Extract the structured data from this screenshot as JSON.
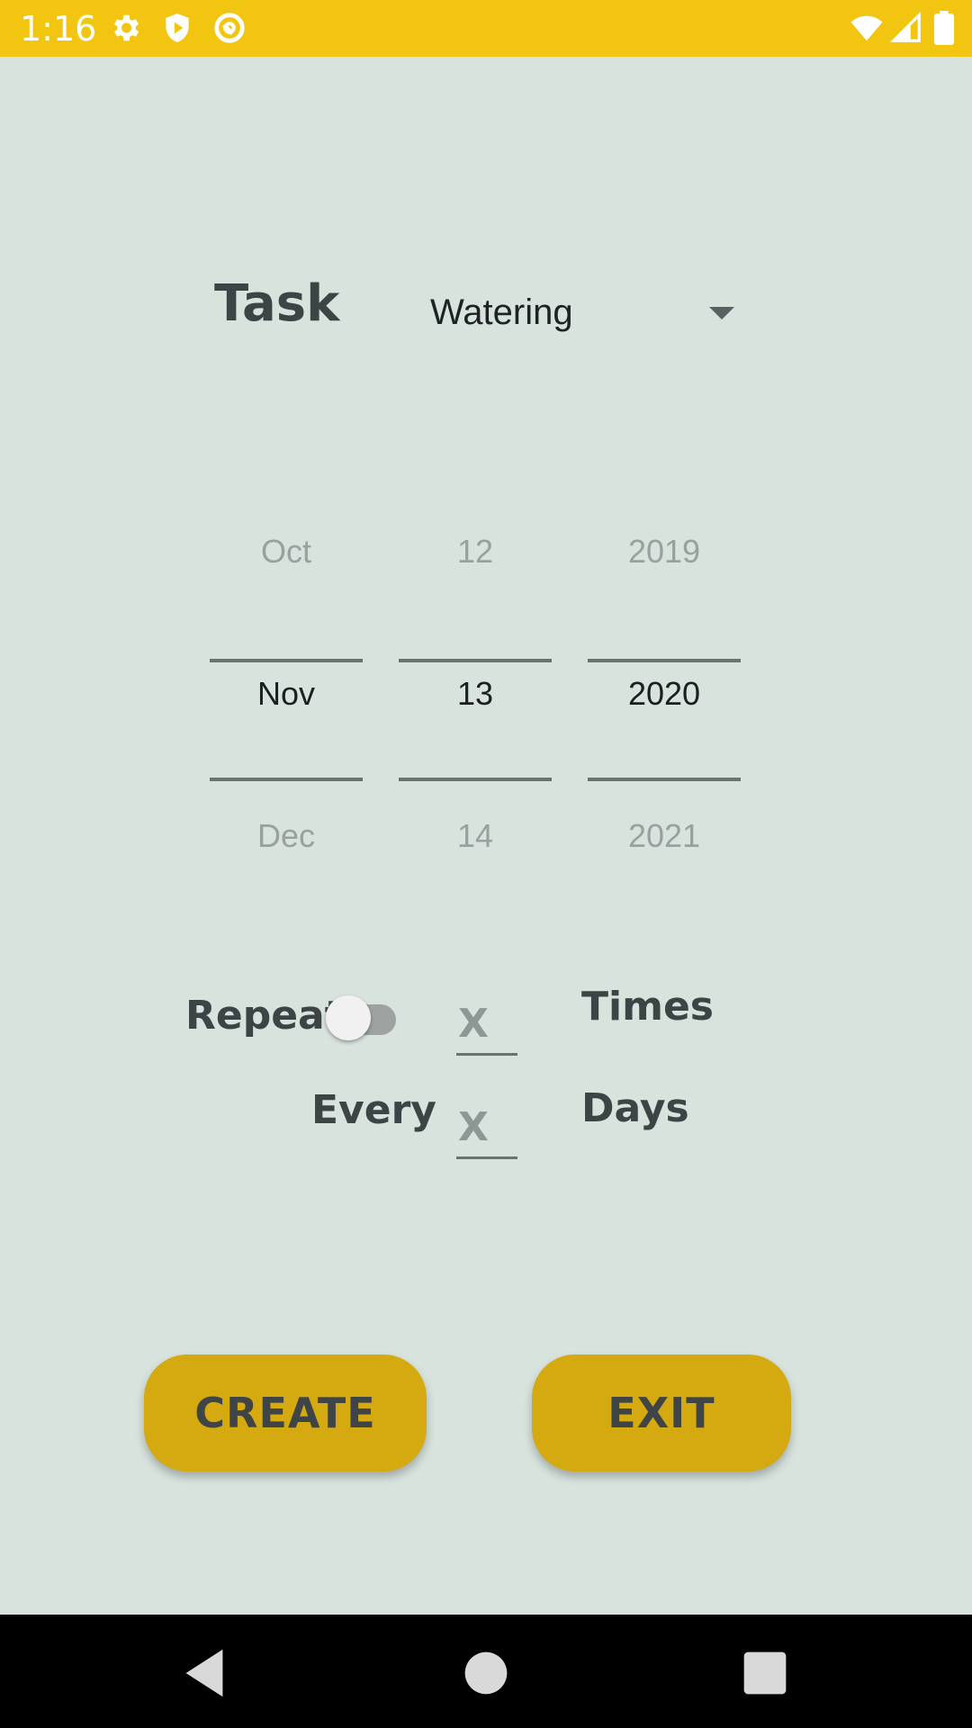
{
  "status_bar": {
    "time": "1:16",
    "left_icons": [
      "gear-icon",
      "shield-play-icon",
      "sync-circle-icon"
    ],
    "right_icons": [
      "wifi-icon",
      "cell-signal-icon",
      "battery-icon"
    ],
    "color": "#f2c511"
  },
  "form": {
    "task_label": "Task",
    "task_dropdown": {
      "selected": "Watering"
    },
    "date_picker": {
      "month": {
        "prev": "Oct",
        "current": "Nov",
        "next": "Dec"
      },
      "day": {
        "prev": "12",
        "current": "13",
        "next": "14"
      },
      "year": {
        "prev": "2019",
        "current": "2020",
        "next": "2021"
      }
    },
    "repeat": {
      "label": "Repeat",
      "enabled": false,
      "times_placeholder": "X",
      "times_label": "Times",
      "every_label": "Every",
      "days_placeholder": "X",
      "days_label": "Days"
    }
  },
  "buttons": {
    "create": "CREATE",
    "exit": "EXIT",
    "color": "#d4aa10"
  },
  "nav_bar": {
    "icons": [
      "back-icon",
      "home-icon",
      "recents-icon"
    ]
  },
  "background_color": "#d8e3de"
}
